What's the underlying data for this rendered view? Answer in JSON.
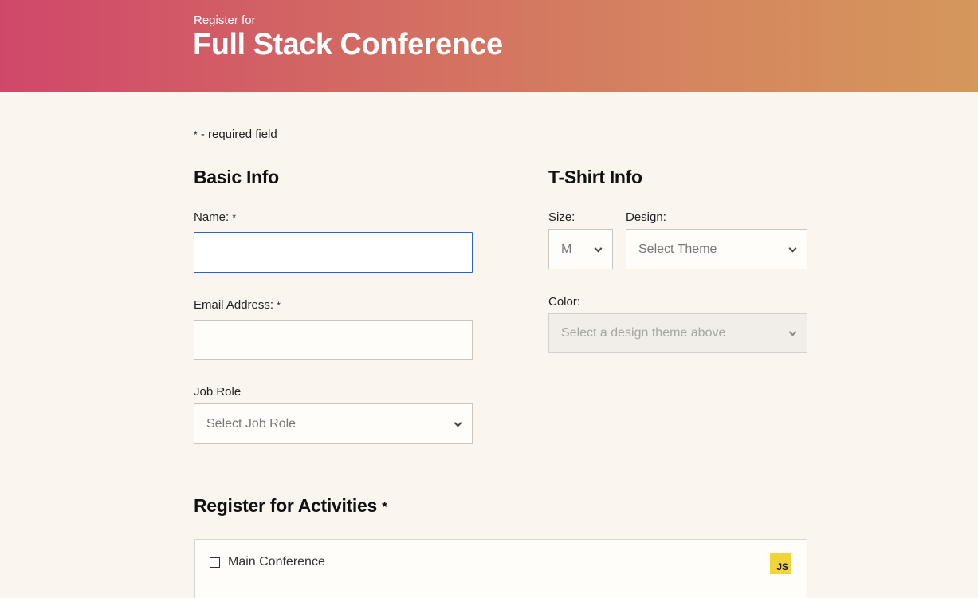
{
  "header": {
    "subtitle": "Register for",
    "title": "Full Stack Conference"
  },
  "required_note": {
    "star": "*",
    "text": " - required field"
  },
  "basic_info": {
    "heading": "Basic Info",
    "name_label": "Name:",
    "name_required": "*",
    "name_value": "",
    "email_label": "Email Address:",
    "email_required": "*",
    "email_value": "",
    "job_label": "Job Role",
    "job_selected": "Select Job Role"
  },
  "tshirt_info": {
    "heading": "T-Shirt Info",
    "size_label": "Size:",
    "size_selected": "M",
    "design_label": "Design:",
    "design_selected": "Select Theme",
    "color_label": "Color:",
    "color_selected": "Select a design theme above"
  },
  "activities": {
    "heading": "Register for Activities",
    "required": "*",
    "items": [
      {
        "label": "Main Conference",
        "checked": false,
        "icon": "js-icon",
        "icon_text": "JS"
      }
    ]
  },
  "colors": {
    "accent_focus": "#2a62c9",
    "header_gradient_start": "#d0476a",
    "header_gradient_end": "#d5975b",
    "page_background": "#faf6ef",
    "js_icon": "#f0d43a"
  }
}
